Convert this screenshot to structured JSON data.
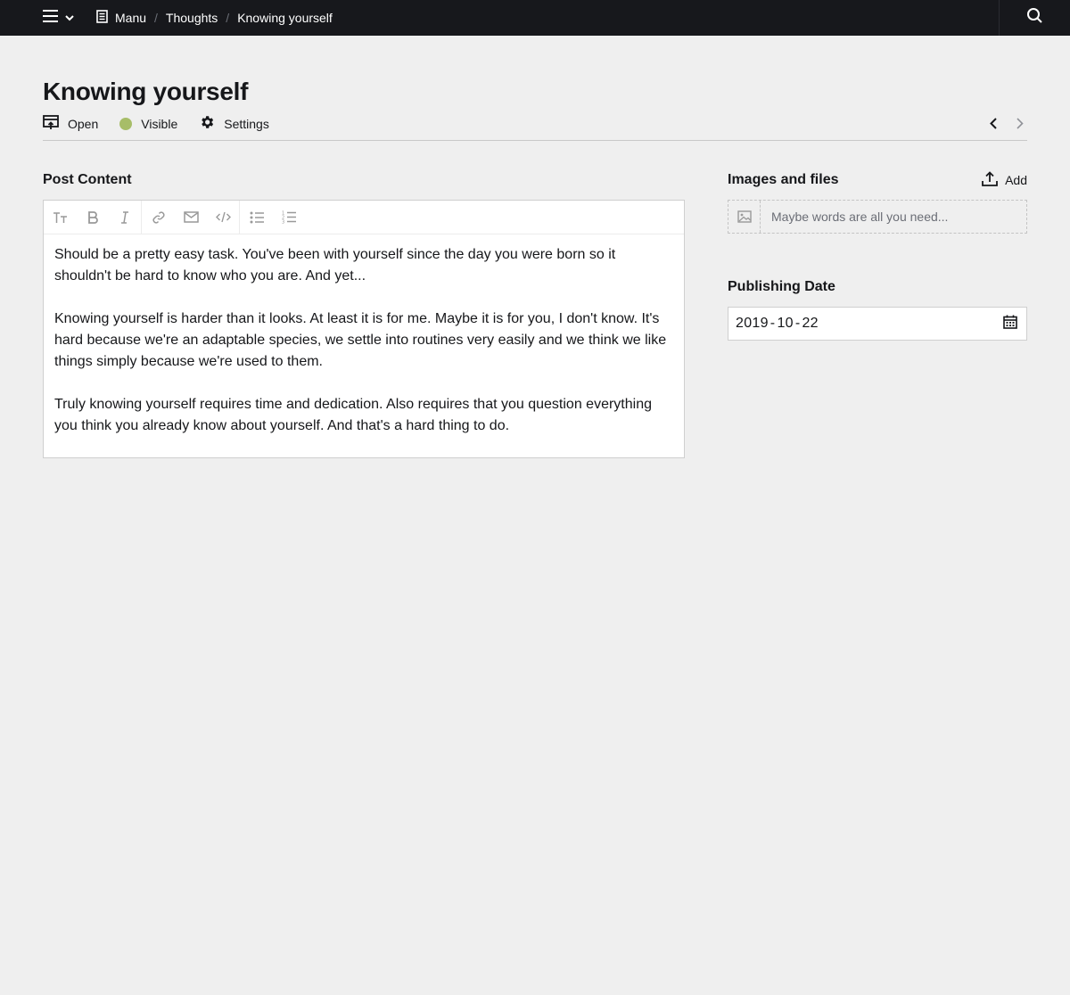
{
  "topbar": {
    "breadcrumbs": [
      "Manu",
      "Thoughts",
      "Knowing yourself"
    ]
  },
  "header": {
    "title": "Knowing yourself",
    "open_label": "Open",
    "status_label": "Visible",
    "status_color": "#a7bd68",
    "settings_label": "Settings"
  },
  "editor": {
    "label": "Post Content",
    "paragraphs": [
      "Should be a pretty easy task. You've been with yourself since the day you were born so it shouldn't be hard to know who you are. And yet...",
      "Knowing yourself is harder than it looks. At least it is for me. Maybe it is for you, I don't know. It's hard because we're an adaptable species, we settle into routines very easily and we think we like things simply because we're used to them.",
      "Truly knowing yourself requires time and dedication. Also requires that you question everything you think you already know about yourself. And that's a hard thing to do."
    ]
  },
  "files": {
    "label": "Images and files",
    "add_label": "Add",
    "empty_text": "Maybe words are all you need..."
  },
  "date": {
    "label": "Publishing Date",
    "year": "2019",
    "month": "10",
    "day": "22"
  }
}
